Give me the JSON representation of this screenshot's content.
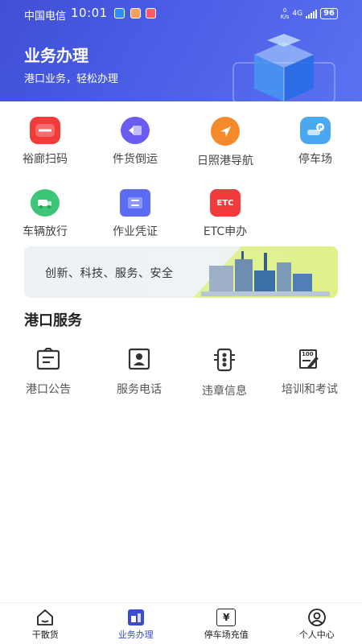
{
  "status_bar": {
    "carrier": "中国电信",
    "time": "10:01",
    "speed_value": "0",
    "speed_unit": "K/s",
    "network": "4G",
    "battery": "96"
  },
  "header": {
    "title": "业务办理",
    "subtitle": "港口业务，轻松办理"
  },
  "quick_actions": [
    {
      "label": "裕廊扫码",
      "icon": "scan-code-icon",
      "color": "#f23b3b"
    },
    {
      "label": "件货倒运",
      "icon": "cargo-transfer-icon",
      "color": "#6a5cf0"
    },
    {
      "label": "日照港导航",
      "icon": "navigation-icon",
      "color": "#f58a2a"
    },
    {
      "label": "停车场",
      "icon": "parking-icon",
      "color": "#4aa8f0"
    },
    {
      "label": "车辆放行",
      "icon": "vehicle-release-icon",
      "color": "#3cc67a"
    },
    {
      "label": "作业凭证",
      "icon": "work-voucher-icon",
      "color": "#5b6cf2"
    },
    {
      "label": "ETC申办",
      "icon": "etc-icon",
      "color": "#f23b3b",
      "icon_text": "ETC"
    }
  ],
  "banner": {
    "text": "创新、科技、服务、安全"
  },
  "port_services": {
    "title": "港口服务",
    "items": [
      {
        "label": "港口公告",
        "icon": "announcement-icon"
      },
      {
        "label": "服务电话",
        "icon": "contact-phone-icon"
      },
      {
        "label": "违章信息",
        "icon": "traffic-light-icon"
      },
      {
        "label": "培训和考试",
        "icon": "exam-icon",
        "icon_text": "100"
      }
    ]
  },
  "tab_bar": {
    "active": "业务办理",
    "tabs": [
      {
        "label": "干散货",
        "icon": "home-icon"
      },
      {
        "label": "业务办理",
        "icon": "business-icon"
      },
      {
        "label": "停车场充值",
        "icon": "recharge-icon",
        "icon_text": "¥"
      },
      {
        "label": "个人中心",
        "icon": "user-icon"
      }
    ]
  },
  "colors": {
    "primary": "#4453dc",
    "active_tab": "#3a4ad1"
  }
}
